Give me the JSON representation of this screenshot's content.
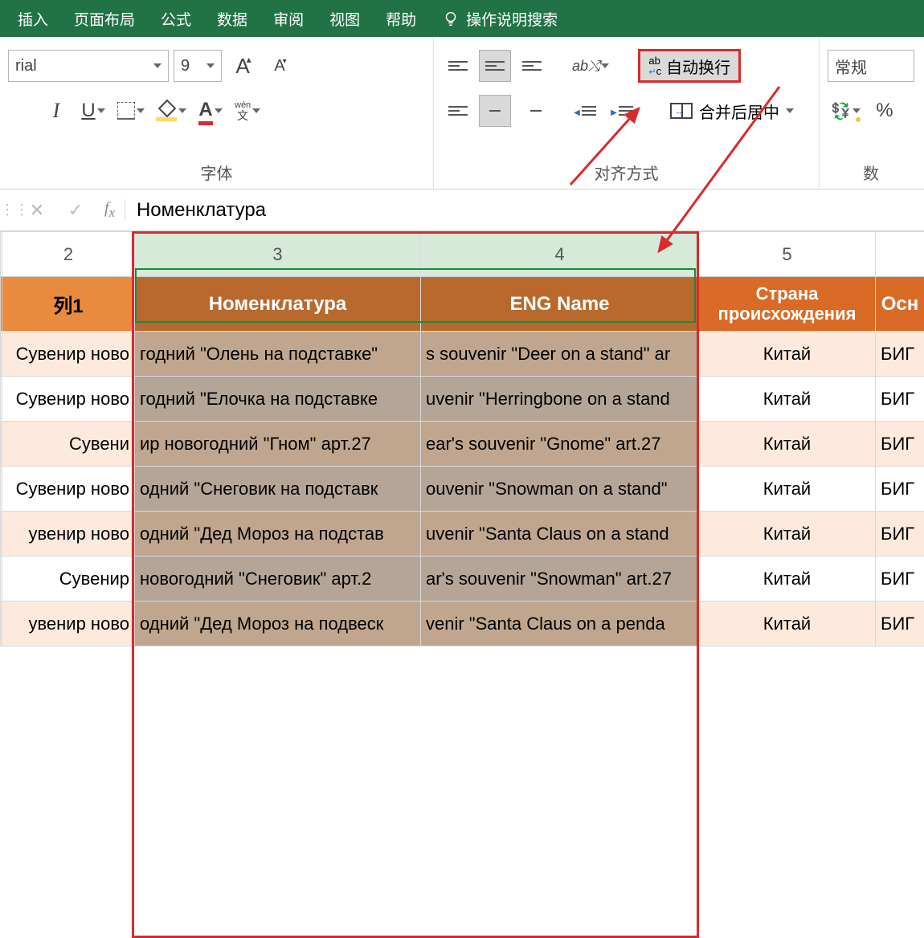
{
  "menu": {
    "insert": "插入",
    "layout": "页面布局",
    "formula": "公式",
    "data": "数据",
    "review": "审阅",
    "view": "视图",
    "help": "帮助",
    "tell": "操作说明搜索"
  },
  "ribbon": {
    "fontGroup": "字体",
    "alignGroup": "对齐方式",
    "fontName": "rial",
    "fontSize": "9",
    "wrapText": "自动换行",
    "mergeCenter": "合并后居中",
    "numberFormat": "常规",
    "percentBtn": "%",
    "phoneticTop": "wén",
    "phoneticBot": "文"
  },
  "fx": {
    "value": "Номенклатура"
  },
  "columns": {
    "c2": "2",
    "c3": "3",
    "c4": "4",
    "c5": "5"
  },
  "headers": {
    "col1": "列1",
    "col3": "Номенклатура",
    "col4": "ENG Name",
    "col5": "Страна происхождения",
    "col6": "Осн"
  },
  "rows": [
    {
      "c2": "Сувенир ново",
      "c3": "годний \"Олень на подставке\"",
      "c4": "s souvenir \"Deer on a stand\" ar",
      "c5": "Китай",
      "c6": "БИГ"
    },
    {
      "c2": "Сувенир ново",
      "c3": "годний \"Елочка на подставке",
      "c4": "uvenir \"Herringbone on a stand",
      "c5": "Китай",
      "c6": "БИГ"
    },
    {
      "c2": "Сувени",
      "c3": "ир новогодний \"Гном\" арт.27",
      "c4": "ear's souvenir \"Gnome\" art.27",
      "c5": "Китай",
      "c6": "БИГ"
    },
    {
      "c2": "Сувенир ново",
      "c3": "одний \"Снеговик на подставк",
      "c4": "ouvenir \"Snowman on a stand\"",
      "c5": "Китай",
      "c6": "БИГ"
    },
    {
      "c2": "увенир ново",
      "c3": "одний \"Дед Мороз на подстав",
      "c4": "uvenir \"Santa Claus on a stand",
      "c5": "Китай",
      "c6": "БИГ"
    },
    {
      "c2": "Сувенир",
      "c3": "новогодний \"Снеговик\" арт.2",
      "c4": "ar's souvenir \"Snowman\" art.27",
      "c5": "Китай",
      "c6": "БИГ"
    },
    {
      "c2": "увенир ново",
      "c3": "одний \"Дед Мороз на подвеск",
      "c4": "venir \"Santa Claus on a penda",
      "c5": "Китай",
      "c6": "БИГ"
    }
  ]
}
